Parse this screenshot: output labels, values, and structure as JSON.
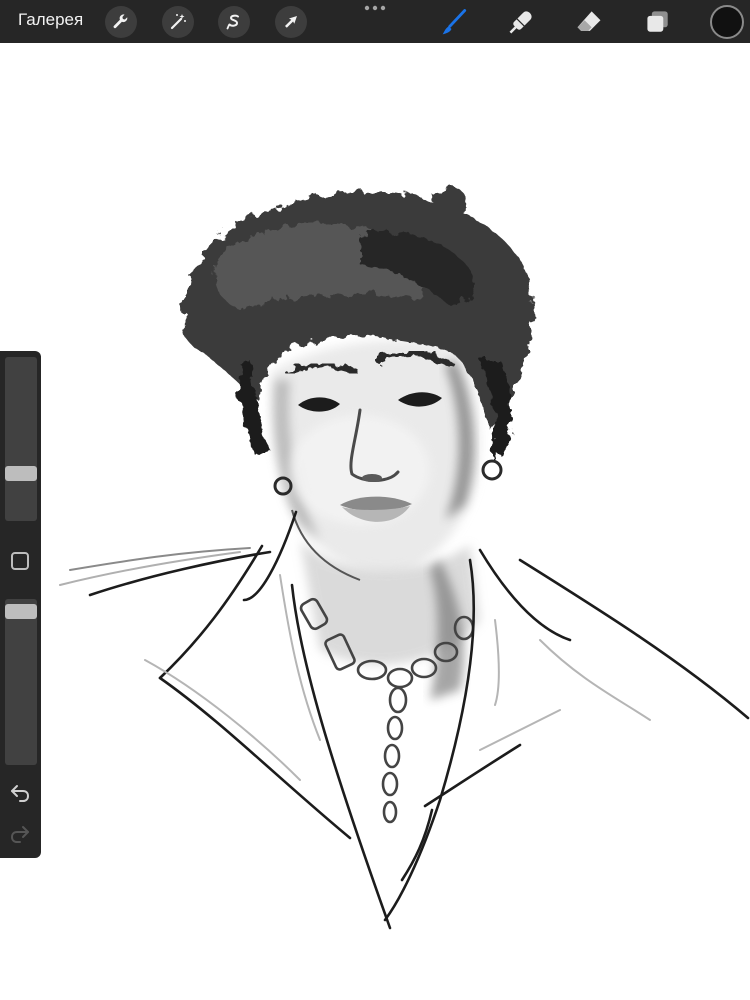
{
  "toolbar": {
    "gallery_label": "Галерея",
    "left_tools": [
      {
        "icon": "wrench-icon"
      },
      {
        "icon": "magic-wand-icon"
      },
      {
        "icon": "selection-icon"
      },
      {
        "icon": "transform-arrow-icon"
      }
    ],
    "right_tools": [
      {
        "icon": "brush-icon",
        "active": true
      },
      {
        "icon": "smudge-icon"
      },
      {
        "icon": "eraser-icon"
      },
      {
        "icon": "layers-icon"
      }
    ],
    "active_tool_color": "#1a73e8",
    "current_color": "#111111"
  },
  "sidebar": {
    "brush_size_level": 0.27,
    "opacity_level": 0.97
  }
}
